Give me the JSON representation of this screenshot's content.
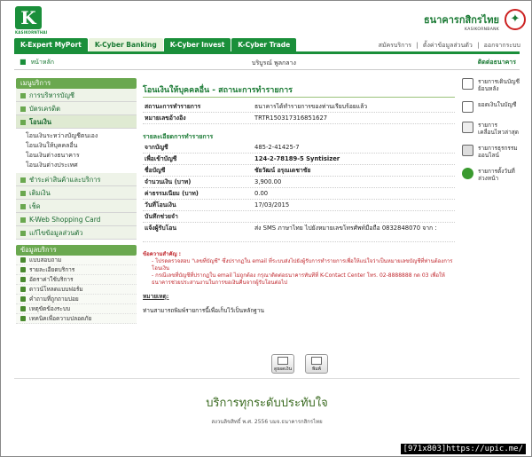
{
  "logo": {
    "letter": "K",
    "caption": "KASIKORNTHAI"
  },
  "bank": {
    "name_th": "ธนาคารกสิกรไทย",
    "name_en": "KASIKORNBANK"
  },
  "tabs": [
    "K-Expert MyPort",
    "K-Cyber Banking",
    "K-Cyber Invest",
    "K-Cyber Trade"
  ],
  "toplinks": [
    "สมัครบริการ",
    "|",
    "ตั้งค่าข้อมูลส่วนตัว",
    "|",
    "ออกจากระบบ"
  ],
  "crumb": {
    "home": "หน้าหลัก",
    "user": "บริบูรณ์ พูลกลาง",
    "contact": "ติดต่อธนาคาร"
  },
  "sidebar": {
    "menu_title": "เมนูบริการ",
    "items": [
      "การบริหารบัญชี",
      "บัตรเครดิต",
      "โอนเงิน"
    ],
    "sub": [
      "โอนเงินระหว่างบัญชีตนเอง",
      "โอนเงินให้บุคคลอื่น",
      "โอนเงินต่างธนาคาร",
      "โอนเงินต่างประเทศ"
    ],
    "items2": [
      "ชำระค่าสินค้าและบริการ",
      "เติมเงิน",
      "เช็ค",
      "K-Web Shopping Card",
      "แก้ไขข้อมูลส่วนตัว"
    ],
    "info_title": "ข้อมูลบริการ",
    "info": [
      "แบบสอบถาม",
      "รายละเอียดบริการ",
      "อัตราค่าใช้บริการ",
      "ดาวน์โหลดแบบฟอร์ม",
      "คำถามที่ถูกถามบ่อย",
      "เหตุขัดข้องระบบ",
      "เทคนิคเพื่อความปลอดภัย"
    ]
  },
  "main": {
    "title": "โอนเงินให้บุคคลอื่น - สถานะการทำรายการ",
    "status_k": "สถานะการทำรายการ",
    "status_v": "ธนาคารได้ทำรายการของท่านเรียบร้อยแล้ว",
    "ref_k": "หมายเลขอ้างอิง",
    "ref_v": "TRTR150317316851627",
    "detail_title": "รายละเอียดการทำรายการ",
    "rows": [
      {
        "k": "จากบัญชี",
        "v": "485-2-41425-7"
      },
      {
        "k": "เพื่อเข้าบัญชี",
        "v": "124-2-78189-5 Syntisizer"
      },
      {
        "k": "ชื่อบัญชี",
        "v": "ชัยวัฒน์ อรุณเดชาชัย"
      },
      {
        "k": "จำนวนเงิน (บาท)",
        "v": "3,900.00"
      },
      {
        "k": "ค่าธรรมเนียม (บาท)",
        "v": "0.00"
      },
      {
        "k": "วันที่โอนเงิน",
        "v": "17/03/2015"
      },
      {
        "k": "บันทึกช่วยจำ",
        "v": ""
      },
      {
        "k": "แจ้งผู้รับโอน",
        "v": "ส่ง SMS ภาษาไทย ไปยังหมายเลขโทรศัพท์มือถือ 0832848070 จาก :"
      }
    ],
    "note_h": "ข้อความสำคัญ :",
    "note1": "- โปรดตรวจสอบ \"เลขที่บัญชี\" ซึ่งปรากฏใน email ที่ระบบส่งไปยังผู้รับการทำรายการเพื่อให้แน่ใจว่าเป็นหมายเลขบัญชีที่ท่านต้องการโอนเงิน",
    "note2": "- กรณีเลขที่บัญชีที่ปรากฏใน email ไม่ถูกต้อง กรุณาติดต่อธนาคารทันทีที่ K-Contact Center โทร. 02-8888888 กด 03 เพื่อให้ธนาคารช่วยประสานงานในการขอเงินคืนจากผู้รับโอนต่อไป",
    "remark_h": "หมายเหตุ:",
    "remark": "ท่านสามารถพิมพ์รายการนี้เพื่อเก็บไว้เป็นหลักฐาน",
    "btn_balance": "ดูยอดเงิน",
    "btn_print": "พิมพ์"
  },
  "right": [
    "รายการเดินบัญชีย้อนหลัง",
    "ยอดเงินในบัญชี",
    "รายการเคลื่อนไหวล่าสุด",
    "รายการธุรกรรมออนไลน์",
    "รายการตั้งวันที่ล่วงหน้า"
  ],
  "footer": {
    "title": "บริการทุกระดับประทับใจ",
    "sub": "สงวนลิขสิทธิ์ พ.ศ. 2556 บมจ.ธนาคารกสิกรไทย"
  },
  "watermark": "[971x803]https://upic.me/",
  "colors": {
    "brand": "#1a8f3a",
    "alert": "#c0272d"
  }
}
